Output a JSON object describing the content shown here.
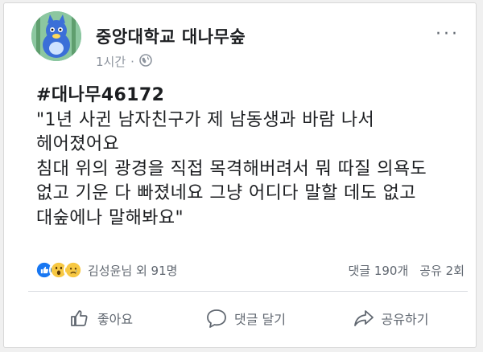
{
  "post": {
    "page_name": "중앙대학교 대나무숲",
    "time": "1시간",
    "separator": "·",
    "hashtag": "#대나무46172",
    "lines": [
      "\"1년 사귄 남자친구가 제 남동생과 바람 나서",
      "헤어졌어요",
      "침대 위의 광경을 직접 목격해버려서 뭐 따질 의욕도",
      "없고 기운 다 빠졌네요 그냥 어디다 말할 데도 없고",
      "대숲에나 말해봐요\""
    ]
  },
  "stats": {
    "reaction_names": "김성윤님 외 91명",
    "comments": "댓글 190개",
    "shares": "공유 2회"
  },
  "actions": {
    "like": "좋아요",
    "comment": "댓글 달기",
    "share": "공유하기"
  },
  "colors": {
    "like_blue": "#1877f2",
    "wow_yellow": "#f7c843",
    "text_gray": "#606770"
  },
  "icons": [
    "globe-icon",
    "more-icon",
    "like-reaction-icon",
    "wow-reaction-icon",
    "sad-reaction-icon",
    "thumbs-up-icon",
    "comment-icon",
    "share-icon"
  ]
}
